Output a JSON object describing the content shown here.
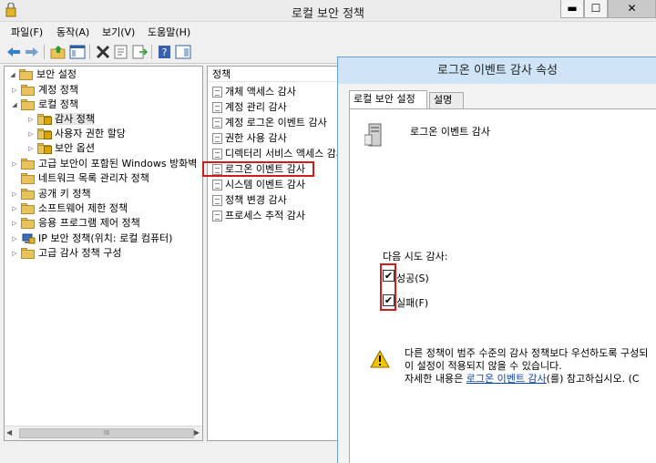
{
  "window": {
    "title": "로컬 보안 정책",
    "controls": {
      "min": "▬",
      "max": "☐",
      "close": "✕"
    }
  },
  "menu": [
    "파일(F)",
    "동작(A)",
    "보기(V)",
    "도움말(H)"
  ],
  "tree": {
    "items": [
      {
        "label": "보안 설정",
        "level": 0,
        "expander": "◢",
        "icon": "folder-icon"
      },
      {
        "label": "계정 정책",
        "level": 1,
        "expander": "▷",
        "icon": "folder-icon"
      },
      {
        "label": "로컬 정책",
        "level": 1,
        "expander": "◢",
        "icon": "folder-icon"
      },
      {
        "label": "감사 정책",
        "level": 2,
        "expander": "▷",
        "icon": "folder-lock-icon",
        "selected": true
      },
      {
        "label": "사용자 권한 할당",
        "level": 2,
        "expander": "▷",
        "icon": "folder-lock-icon"
      },
      {
        "label": "보안 옵션",
        "level": 2,
        "expander": "▷",
        "icon": "folder-lock-icon"
      },
      {
        "label": "고급 보안이 포함된 Windows 방화벽",
        "level": 1,
        "expander": "▷",
        "icon": "folder-icon"
      },
      {
        "label": "네트워크 목록 관리자 정책",
        "level": 1,
        "expander": "",
        "icon": "folder-icon"
      },
      {
        "label": "공개 키 정책",
        "level": 1,
        "expander": "▷",
        "icon": "folder-icon"
      },
      {
        "label": "소프트웨어 제한 정책",
        "level": 1,
        "expander": "▷",
        "icon": "folder-icon"
      },
      {
        "label": "응용 프로그램 제어 정책",
        "level": 1,
        "expander": "▷",
        "icon": "folder-icon"
      },
      {
        "label": "IP 보안 정책(위치: 로컬 컴퓨터)",
        "level": 1,
        "expander": "▷",
        "icon": "ip-security-icon"
      },
      {
        "label": "고급 감사 정책 구성",
        "level": 1,
        "expander": "▷",
        "icon": "folder-icon"
      }
    ],
    "scroll_thumb": "III"
  },
  "list": {
    "header": "정책",
    "items": [
      "개체 액세스 감사",
      "계정 관리 감사",
      "계정 로그온 이벤트 감사",
      "권한 사용 감사",
      "디렉터리 서비스 액세스 감사",
      "로그온 이벤트 감사",
      "시스템 이벤트 감사",
      "정책 변경 감사",
      "프로세스 추적 감사"
    ]
  },
  "dialog": {
    "title": "로그온 이벤트 감사 속성",
    "tabs": [
      "로컬 보안 설정",
      "설명"
    ],
    "policy_name": "로그온 이벤트 감사",
    "try_label": "다음 시도 감사:",
    "success_label": "성공(S)",
    "failure_label": "실패(F)",
    "success_checked": true,
    "failure_checked": true,
    "check_mark": "✔",
    "warning_line1": "다른 정책이 범주 수준의 감사 정책보다 우선하도록 구성되",
    "warning_line2": "이 설정이 적용되지 않을 수 있습니다.",
    "warning_line3_pre": "자세한 내용은 ",
    "warning_link": "로그온 이벤트 감사",
    "warning_line3_post": "(를) 참고하십시오. (C"
  },
  "colors": {
    "highlight_box": "#d21b1b",
    "link": "#0645ad",
    "dialog_title_bg": "#cfe4f7"
  }
}
